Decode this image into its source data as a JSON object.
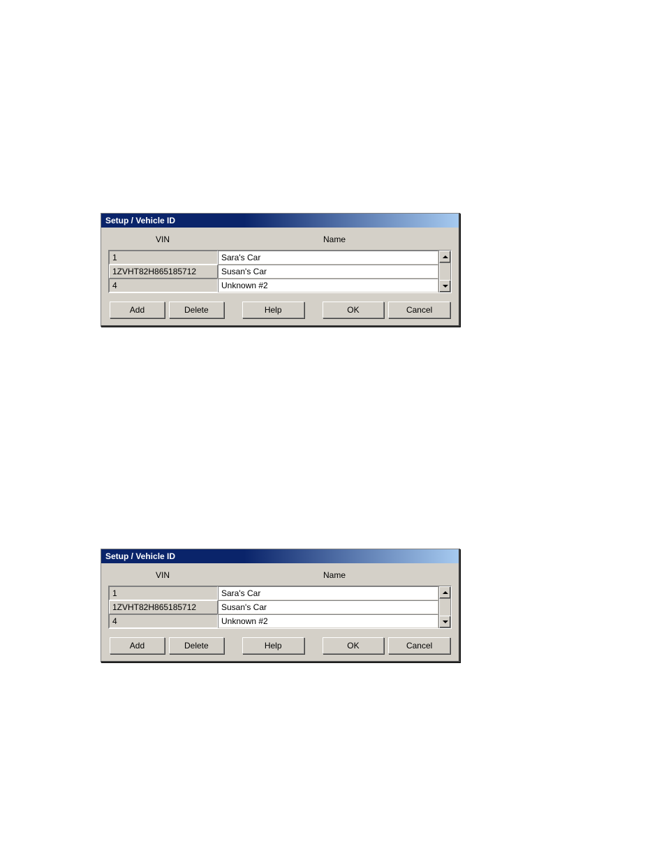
{
  "dialog1": {
    "title": "Setup / Vehicle ID",
    "headers": {
      "vin": "VIN",
      "name": "Name"
    },
    "rows": [
      {
        "vin": "1",
        "name": "Sara's Car",
        "selected": false
      },
      {
        "vin": "1ZVHT82H865185712",
        "name": "Susan's Car",
        "selected": true
      },
      {
        "vin": "4",
        "name": "Unknown #2",
        "selected": false
      }
    ],
    "buttons": {
      "add": "Add",
      "delete": "Delete",
      "help": "Help",
      "ok": "OK",
      "cancel": "Cancel"
    }
  },
  "dialog2": {
    "title": "Setup / Vehicle ID",
    "headers": {
      "vin": "VIN",
      "name": "Name"
    },
    "rows": [
      {
        "vin": "1",
        "name": "Sara's Car",
        "selected": false
      },
      {
        "vin": "1ZVHT82H865185712",
        "name": "Susan's Car",
        "selected": true
      },
      {
        "vin": "4",
        "name": "Unknown #2",
        "selected": false
      }
    ],
    "buttons": {
      "add": "Add",
      "delete": "Delete",
      "help": "Help",
      "ok": "OK",
      "cancel": "Cancel"
    }
  }
}
